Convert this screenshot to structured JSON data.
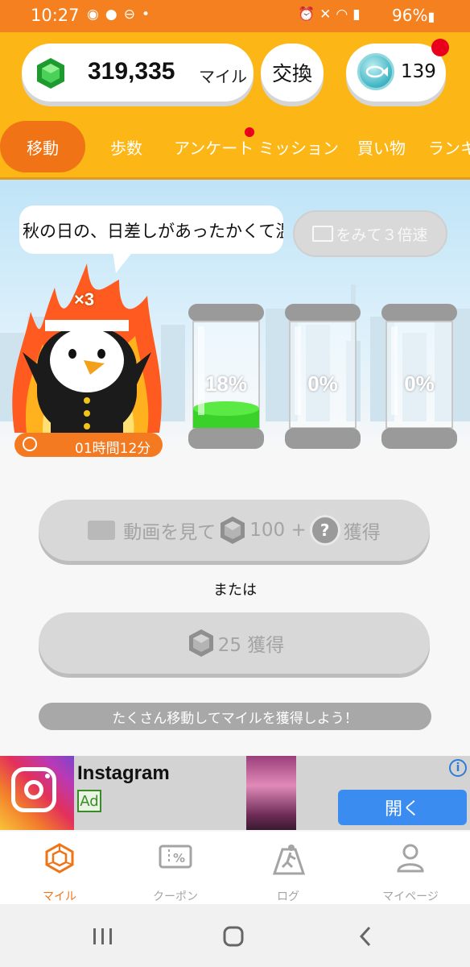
{
  "status_bar": {
    "time": "10:27",
    "battery": "96%",
    "left_icons": [
      "owl-icon",
      "location-icon",
      "block-icon",
      "dot"
    ],
    "right_icons": [
      "alarm-icon",
      "mute-icon",
      "wifi-icon",
      "signal-icon"
    ]
  },
  "header": {
    "miles_value": "319,335",
    "miles_unit": "マイル",
    "exchange_label": "交換",
    "coin_value": "139"
  },
  "tabs": [
    {
      "label": "移動",
      "active": true
    },
    {
      "label": "歩数"
    },
    {
      "label": "アンケート",
      "badge": true
    },
    {
      "label": "ミッション"
    },
    {
      "label": "買い物"
    },
    {
      "label": "ランキ"
    }
  ],
  "hero": {
    "bubble_text": "秋の日の、日差しがあったかくて温",
    "speed_button": "をみて３倍速",
    "multiplier": "×3",
    "timer": "01時間12分",
    "jars": [
      {
        "label": "18%",
        "fill": 0.18
      },
      {
        "label": "0%",
        "fill": 0
      },
      {
        "label": "0%",
        "fill": 0
      }
    ]
  },
  "actions": {
    "video_button_prefix": "動画を見て",
    "video_button_amount": "100 +",
    "video_button_suffix": "獲得",
    "or_label": "または",
    "earn_button": "25 獲得",
    "hint": "たくさん移動してマイルを獲得しよう！"
  },
  "ad": {
    "title": "Instagram",
    "badge": "Ad",
    "open_button": "開く",
    "info": "i"
  },
  "bottom_nav": [
    {
      "label": "マイル",
      "icon": "hex-gem-icon",
      "active": true
    },
    {
      "label": "クーポン",
      "icon": "coupon-icon"
    },
    {
      "label": "ログ",
      "icon": "walk-log-icon"
    },
    {
      "label": "マイページ",
      "icon": "person-icon"
    }
  ],
  "colors": {
    "accent_orange": "#f07416",
    "header_yellow": "#fcb616",
    "badge_red": "#e8001c",
    "fill_green": "#39d12a"
  }
}
